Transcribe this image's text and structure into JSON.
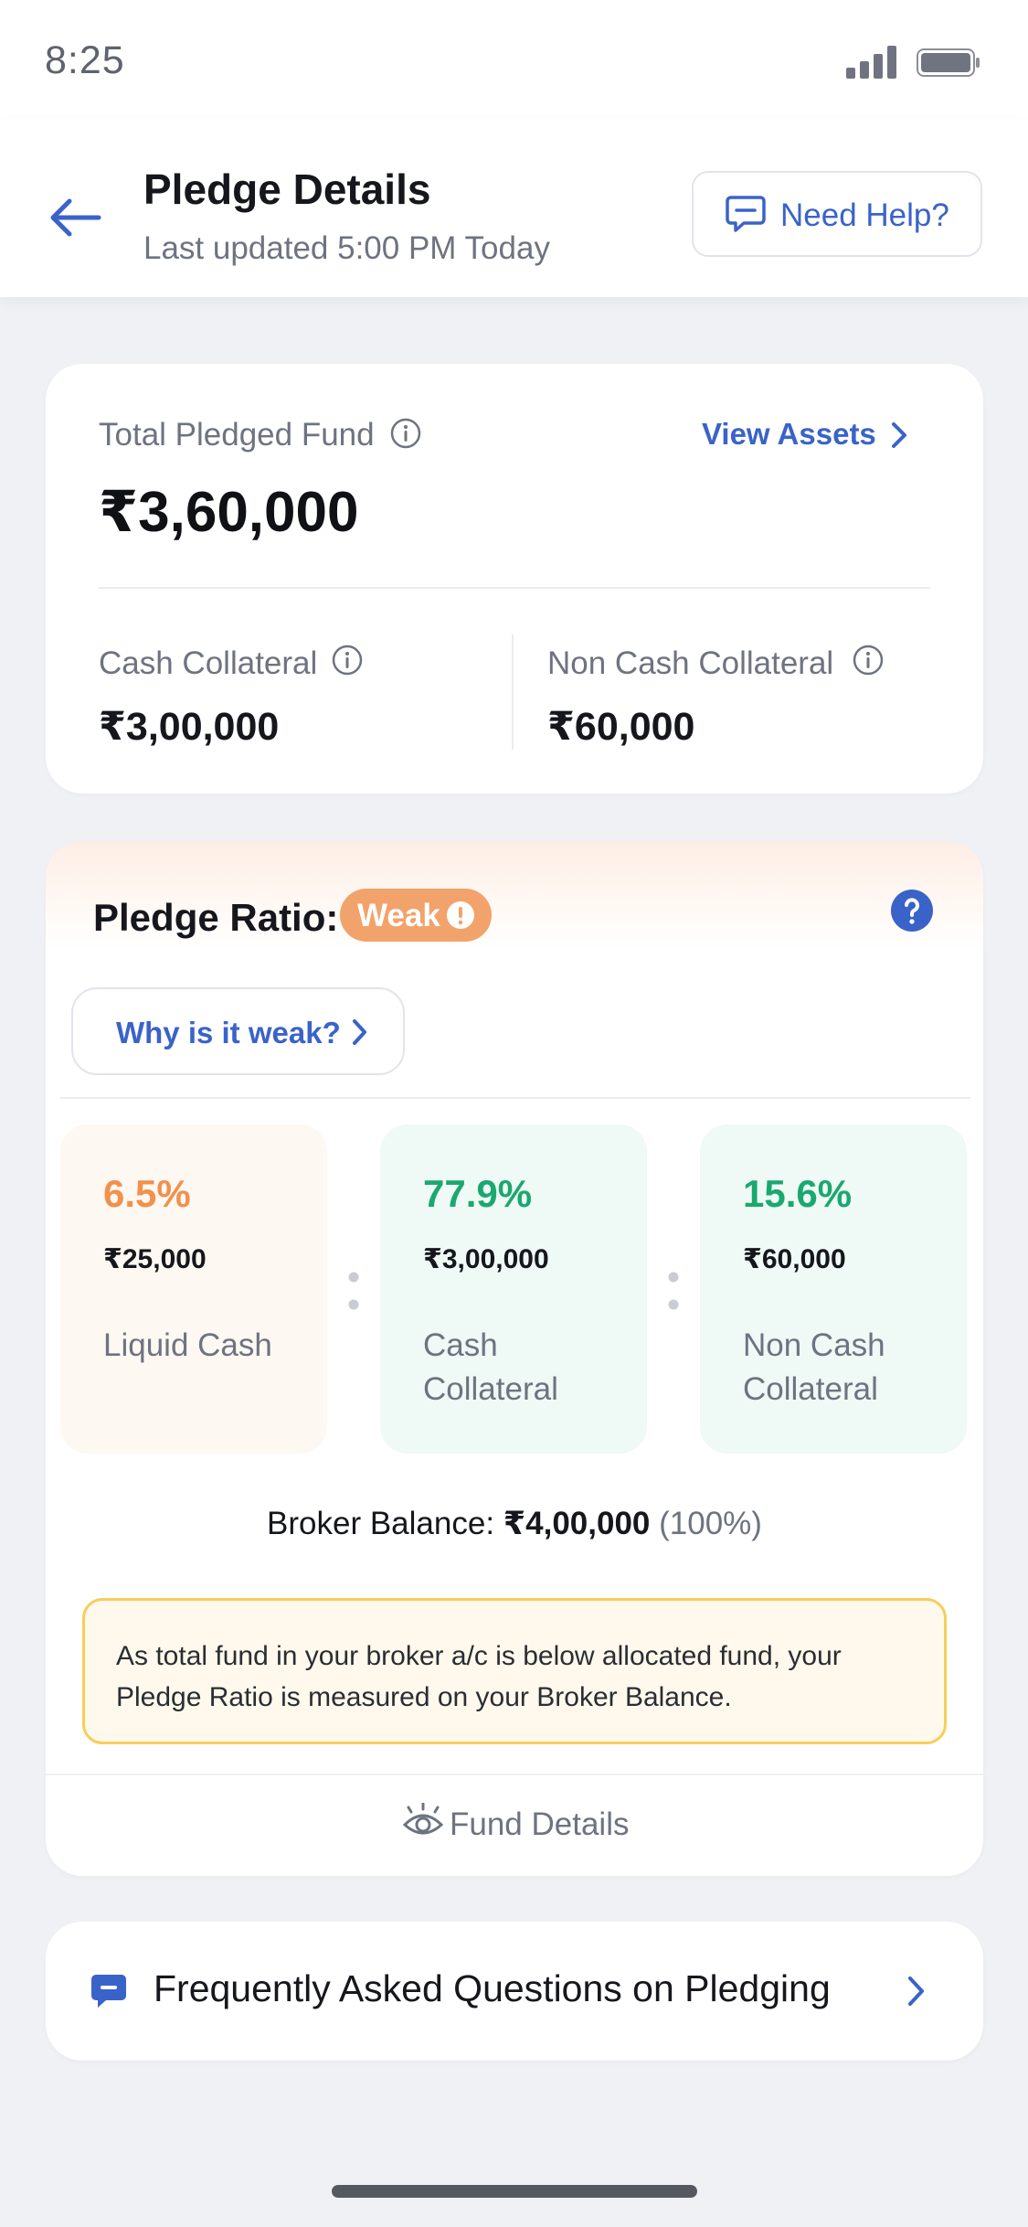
{
  "status_bar": {
    "time": "8:25"
  },
  "header": {
    "title": "Pledge Details",
    "subtitle": "Last updated 5:00 PM Today",
    "help_label": "Need Help?"
  },
  "summary": {
    "total_label": "Total Pledged Fund",
    "total_value": "₹3,60,000",
    "view_assets_label": "View Assets",
    "cash_collateral_label": "Cash Collateral",
    "cash_collateral_value": "₹3,00,000",
    "non_cash_collateral_label": "Non Cash Collateral",
    "non_cash_collateral_value": "₹60,000"
  },
  "pledge_ratio": {
    "title": "Pledge Ratio:",
    "status_badge": "Weak",
    "why_label": "Why is it weak?",
    "breakdown": [
      {
        "percent": "6.5%",
        "amount": "₹25,000",
        "label": "Liquid Cash"
      },
      {
        "percent": "77.9%",
        "amount": "₹3,00,000",
        "label": "Cash Collateral"
      },
      {
        "percent": "15.6%",
        "amount": "₹60,000",
        "label": "Non Cash Collateral"
      }
    ],
    "broker_balance_label": "Broker Balance:",
    "broker_balance_value": "₹4,00,000",
    "broker_balance_pct": "(100%)",
    "note": "As total fund in your broker a/c is below allocated fund, your Pledge Ratio is measured on your Broker Balance.",
    "fund_details_label": "Fund Details"
  },
  "faq": {
    "label": "Frequently Asked Questions on Pledging"
  },
  "colors": {
    "accent": "#3a63c9",
    "weak": "#f2a36b",
    "liquid": "#f2904c",
    "healthy": "#1ba86f",
    "note_border": "#f7ce5a"
  },
  "icons": [
    "signal-icon",
    "battery-icon",
    "back-arrow-icon",
    "chat-help-icon",
    "info-icon",
    "chevron-right-icon",
    "alert-icon",
    "question-icon",
    "eye-icon",
    "chat-icon"
  ]
}
